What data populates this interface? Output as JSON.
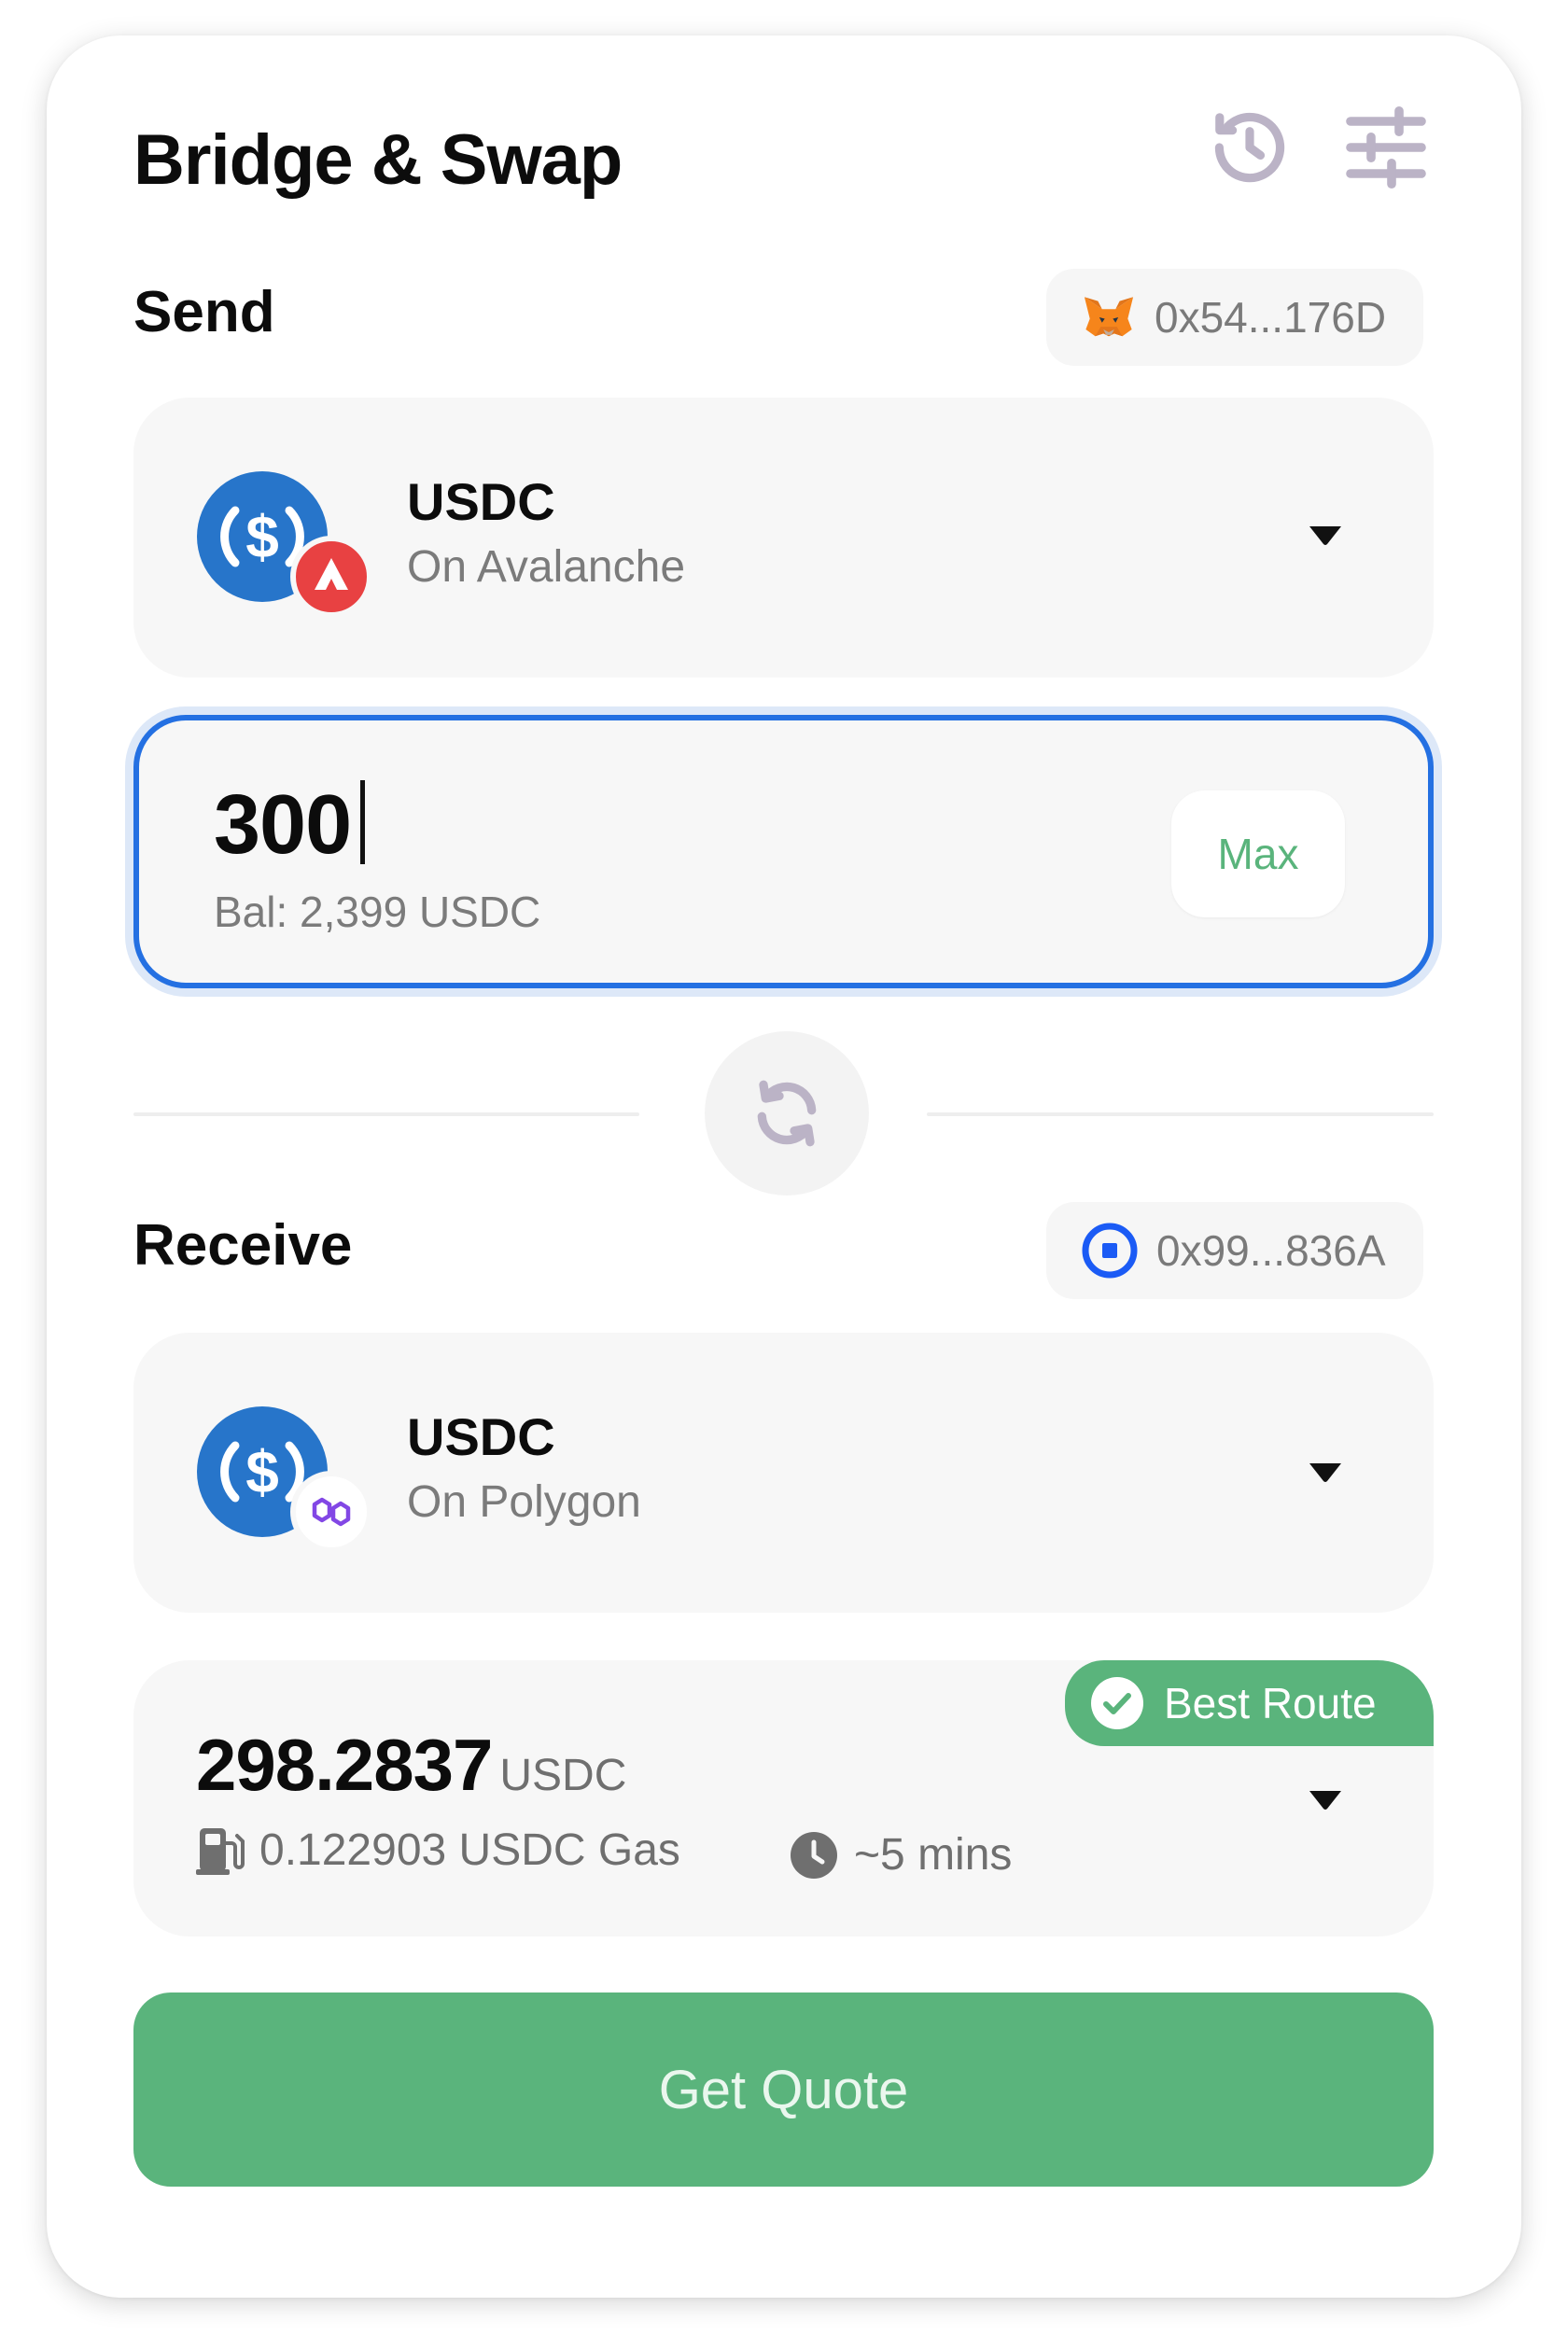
{
  "header": {
    "title": "Bridge & Swap",
    "history_icon": "history-icon",
    "settings_icon": "settings-sliders-icon"
  },
  "send": {
    "label": "Send",
    "wallet_icon": "metamask-fox-icon",
    "wallet_address": "0x54...176D",
    "token": {
      "symbol": "USDC",
      "chain": "On Avalanche",
      "logo": "usdc-logo",
      "chain_badge": "avalanche-badge"
    },
    "amount": "300",
    "balance": "Bal: 2,399 USDC",
    "max_label": "Max"
  },
  "swap_icon": "swap-arrows-icon",
  "receive": {
    "label": "Receive",
    "wallet_icon": "coinbase-wallet-icon",
    "wallet_address": "0x99...836A",
    "token": {
      "symbol": "USDC",
      "chain": "On Polygon",
      "logo": "usdc-logo",
      "chain_badge": "polygon-badge"
    }
  },
  "route": {
    "badge": "Best Route",
    "amount": "298.2837",
    "unit": "USDC",
    "gas": "0.122903 USDC Gas",
    "time": "~5 mins"
  },
  "cta": {
    "label": "Get Quote"
  },
  "colors": {
    "accent_green": "#5ab47c",
    "focus_blue": "#2470e2",
    "usdc_blue": "#2775ca",
    "avalanche_red": "#e84142",
    "polygon_purple": "#8247e5",
    "icon_grey": "#bbb3c6"
  }
}
